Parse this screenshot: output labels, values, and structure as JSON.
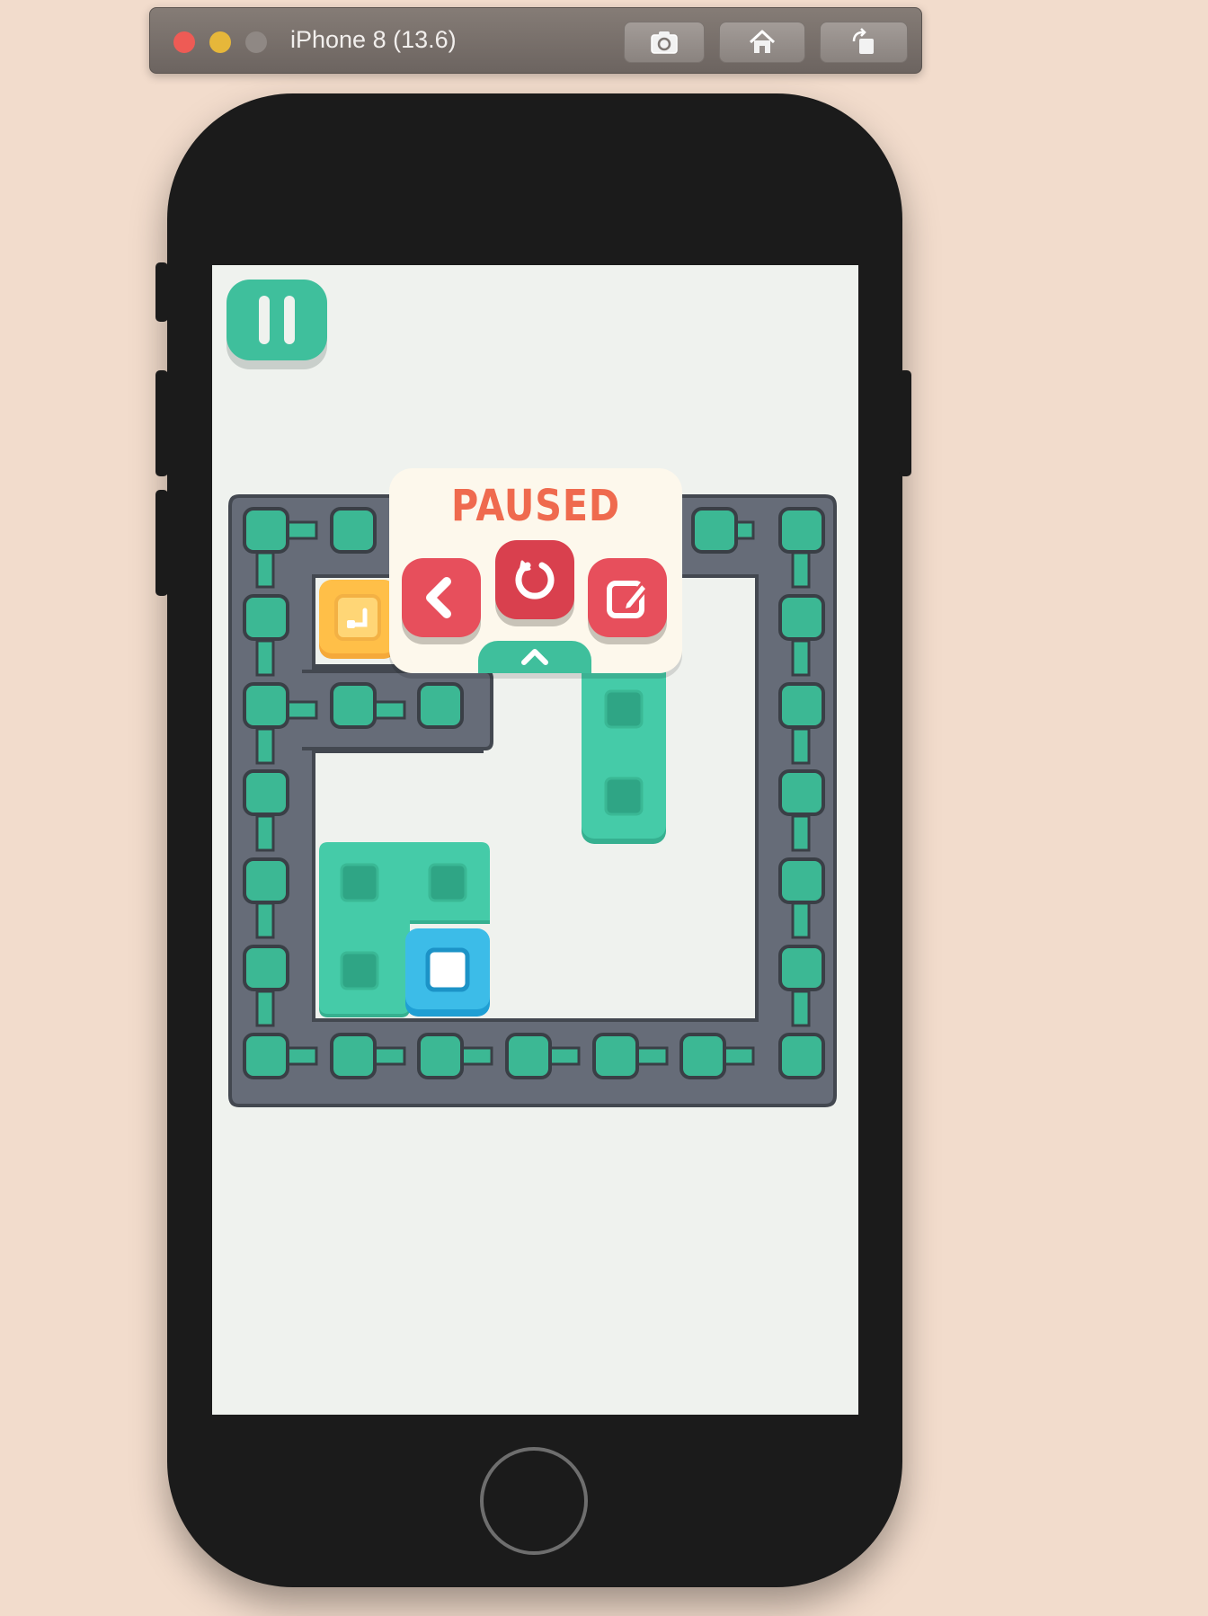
{
  "window": {
    "title": "iPhone 8 (13.6)",
    "buttons": [
      "screenshot-icon",
      "home-icon",
      "rotate-icon"
    ]
  },
  "game": {
    "pause_button": "pause-icon",
    "popup": {
      "title": "PAUSED",
      "buttons": [
        "back-icon",
        "restart-icon",
        "edit-icon"
      ],
      "collapse_tab": "chevron-up-icon"
    },
    "pieces": [
      {
        "name": "yellow-goal-block",
        "color": "#ffbf48"
      },
      {
        "name": "teal-vertical-block",
        "color": "#45cba8"
      },
      {
        "name": "teal-l-block",
        "color": "#45cba8"
      },
      {
        "name": "blue-player-block",
        "color": "#3cbce8"
      }
    ]
  },
  "colors": {
    "accent": "#3fbf9c",
    "danger": "#e74f5c",
    "wall": "#4f545c",
    "background": "#eff2ee",
    "desktop": "#f2dccc"
  }
}
